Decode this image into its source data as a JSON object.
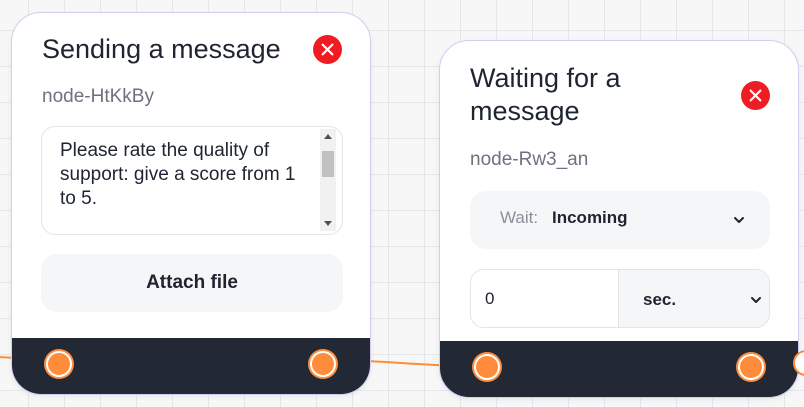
{
  "nodes": [
    {
      "title": "Sending a message",
      "id": "node-HtKkBy",
      "message": "Please rate the quality of support: give a score from 1 to 5.",
      "attach_label": "Attach file"
    },
    {
      "title": "Waiting for a message",
      "id": "node-Rw3_an",
      "wait_label": "Wait:",
      "wait_value": "Incoming",
      "timeout_value": "0",
      "timeout_unit": "sec."
    }
  ],
  "colors": {
    "accent": "#ff8c3a",
    "close": "#ef1c24",
    "footer": "#222834",
    "node_border": "#d3cdf4"
  },
  "icons": {
    "close": "x-icon",
    "dropdown": "chevron-down-icon",
    "port": "connector-port"
  }
}
